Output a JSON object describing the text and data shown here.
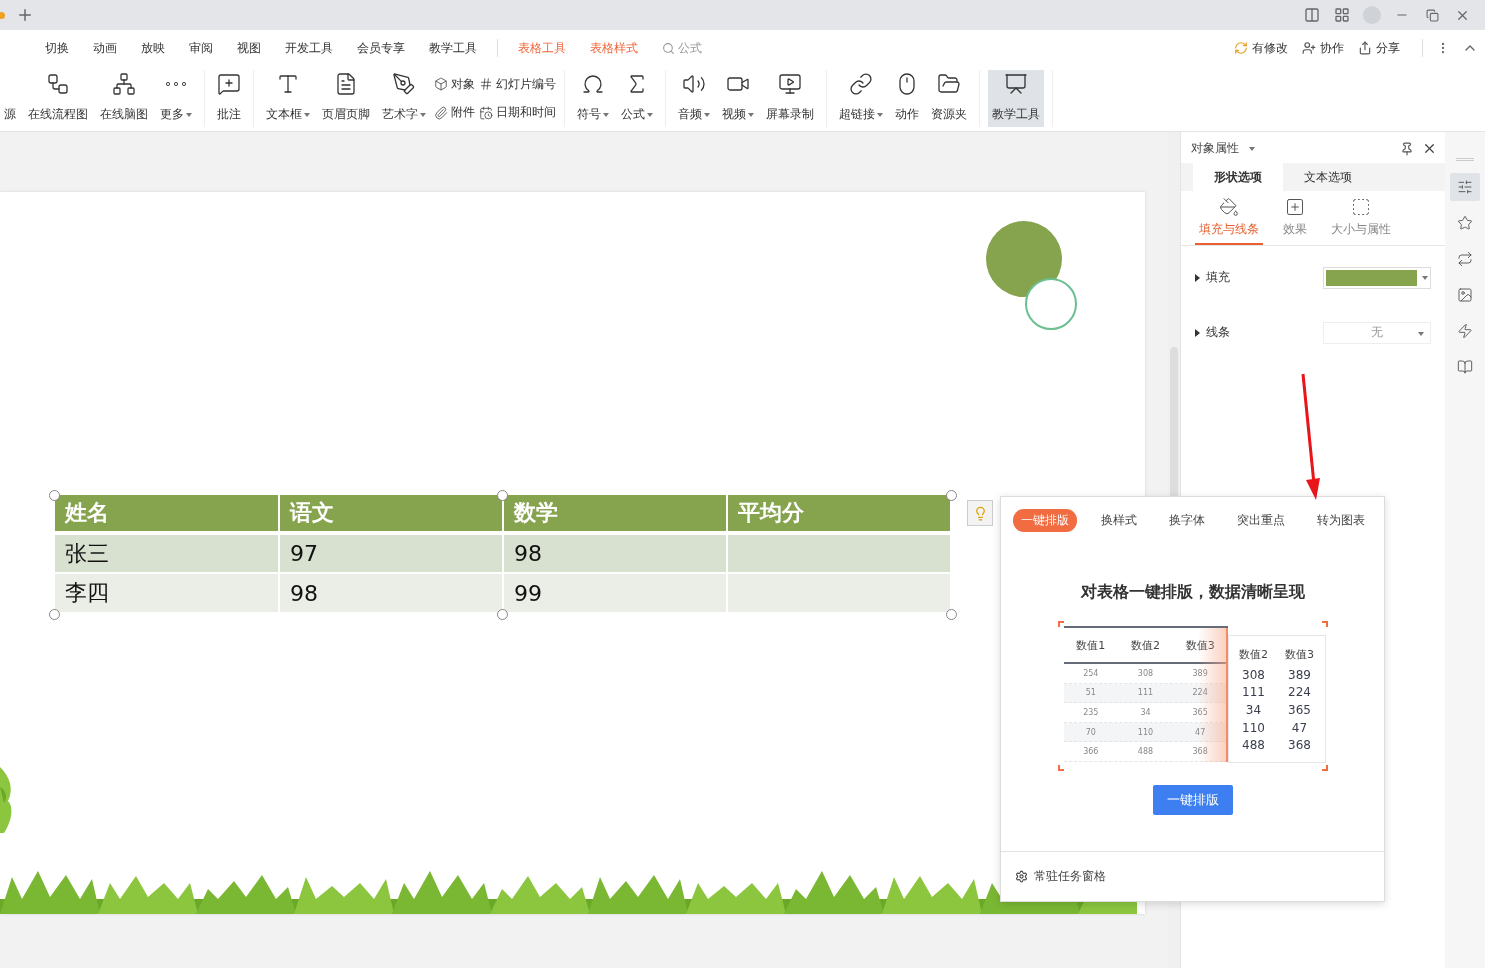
{
  "menu": [
    {
      "label": "切换",
      "kind": "normal"
    },
    {
      "label": "动画",
      "kind": "normal"
    },
    {
      "label": "放映",
      "kind": "normal"
    },
    {
      "label": "审阅",
      "kind": "normal"
    },
    {
      "label": "视图",
      "kind": "normal"
    },
    {
      "label": "开发工具",
      "kind": "normal"
    },
    {
      "label": "会员专享",
      "kind": "normal"
    },
    {
      "label": "教学工具",
      "kind": "normal"
    },
    {
      "label": "表格工具",
      "kind": "contextual"
    },
    {
      "label": "表格样式",
      "kind": "contextual"
    }
  ],
  "search": {
    "placeholder": "公式"
  },
  "actions": [
    "有修改",
    "协作",
    "分享"
  ],
  "ribbon": [
    {
      "items": [
        {
          "kind": "large",
          "label": "源",
          "dropdown": false,
          "active": false
        },
        {
          "kind": "large",
          "label": "在线流程图",
          "dropdown": false,
          "active": false
        },
        {
          "kind": "large",
          "label": "在线脑图",
          "dropdown": false,
          "active": false
        },
        {
          "kind": "large",
          "label": "更多",
          "dropdown": true,
          "active": false
        }
      ]
    },
    {
      "items": [
        {
          "kind": "large",
          "label": "批注",
          "dropdown": false,
          "active": false
        }
      ]
    },
    {
      "items": [
        {
          "kind": "large",
          "label": "文本框",
          "dropdown": true,
          "active": false
        },
        {
          "kind": "large",
          "label": "页眉页脚",
          "dropdown": false,
          "active": false
        },
        {
          "kind": "large",
          "label": "艺术字",
          "dropdown": true,
          "active": false
        },
        {
          "kind": "stack",
          "items": [
            "对象",
            "附件"
          ]
        },
        {
          "kind": "stack",
          "items": [
            "幻灯片编号",
            "日期和时间"
          ]
        }
      ]
    },
    {
      "items": [
        {
          "kind": "large",
          "label": "符号",
          "dropdown": true,
          "active": false
        },
        {
          "kind": "large",
          "label": "公式",
          "dropdown": true,
          "active": false
        }
      ]
    },
    {
      "items": [
        {
          "kind": "large",
          "label": "音频",
          "dropdown": true,
          "active": false
        },
        {
          "kind": "large",
          "label": "视频",
          "dropdown": true,
          "active": false
        },
        {
          "kind": "large",
          "label": "屏幕录制",
          "dropdown": false,
          "active": false
        }
      ]
    },
    {
      "items": [
        {
          "kind": "large",
          "label": "超链接",
          "dropdown": true,
          "active": false
        },
        {
          "kind": "large",
          "label": "动作",
          "dropdown": false,
          "active": false
        },
        {
          "kind": "large",
          "label": "资源夹",
          "dropdown": false,
          "active": false
        }
      ]
    },
    {
      "items": [
        {
          "kind": "large",
          "label": "教学工具",
          "dropdown": false,
          "active": true
        }
      ]
    }
  ],
  "slide_table": {
    "columns": [
      "姓名",
      "语文",
      "数学",
      "平均分"
    ],
    "rows": [
      [
        "张三",
        "97",
        "98",
        ""
      ],
      [
        "李四",
        "98",
        "99",
        ""
      ]
    ]
  },
  "panel": {
    "title": "对象属性",
    "tabs": [
      {
        "label": "形状选项",
        "selected": true
      },
      {
        "label": "文本选项",
        "selected": false
      }
    ],
    "subtabs": [
      {
        "label": "填充与线条",
        "selected": true
      },
      {
        "label": "效果",
        "selected": false
      },
      {
        "label": "大小与属性",
        "selected": false
      }
    ],
    "fill": {
      "label": "填充",
      "color": "#86a34e"
    },
    "line": {
      "label": "线条",
      "value": "无"
    }
  },
  "sidebar": [
    {
      "selected": true
    },
    {
      "selected": false
    },
    {
      "selected": false
    },
    {
      "selected": false
    },
    {
      "selected": false
    },
    {
      "selected": false
    }
  ],
  "popup": {
    "tabs": [
      {
        "label": "一键排版",
        "selected": true
      },
      {
        "label": "换样式",
        "selected": false
      },
      {
        "label": "换字体",
        "selected": false
      },
      {
        "label": "突出重点",
        "selected": false
      },
      {
        "label": "转为图表",
        "selected": false
      }
    ],
    "heading": "对表格一键排版，数据清晰呈现",
    "preview": {
      "columns": [
        "数值1",
        "数值2",
        "数值3"
      ],
      "rows": [
        [
          "254",
          "308",
          "389"
        ],
        [
          "51",
          "111",
          "224"
        ],
        [
          "235",
          "34",
          "365"
        ],
        [
          "70",
          "110",
          "47"
        ],
        [
          "366",
          "488",
          "368"
        ]
      ],
      "result_columns": [
        "数值2",
        "数值3"
      ],
      "result_rows": [
        [
          "308",
          "389"
        ],
        [
          "111",
          "224"
        ],
        [
          "34",
          "365"
        ],
        [
          "110",
          "47"
        ],
        [
          "488",
          "368"
        ]
      ]
    },
    "button": "一键排版",
    "footer": "常驻任务窗格"
  }
}
